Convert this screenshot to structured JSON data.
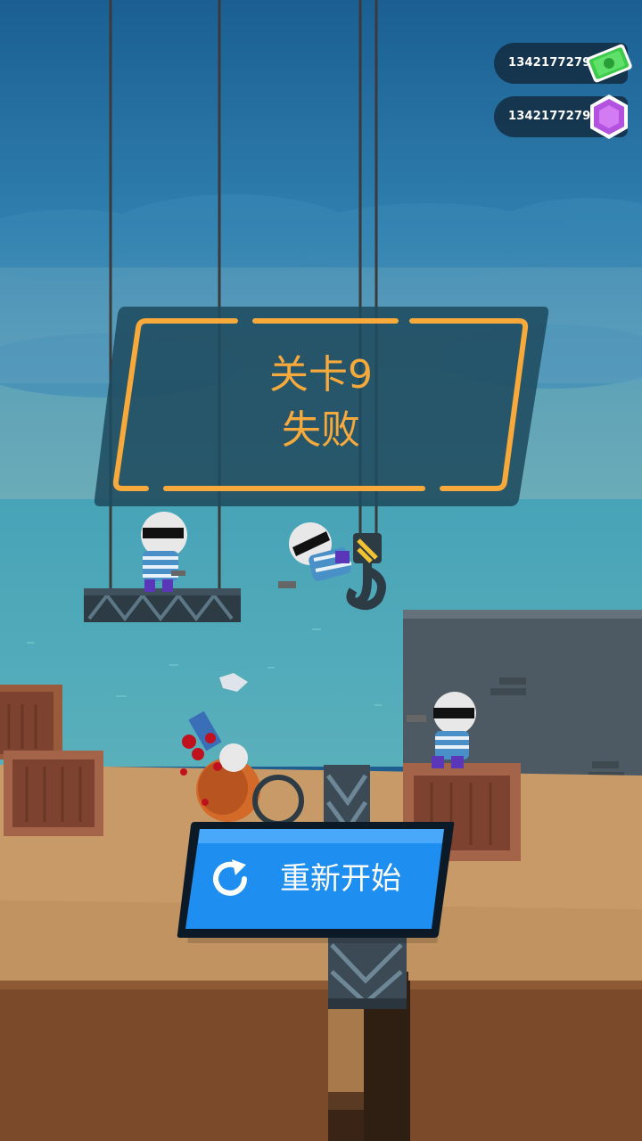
{
  "hud": {
    "cash": {
      "amount": "1342177279",
      "icon": "cash-icon",
      "color": "#3ecb4c"
    },
    "gems": {
      "amount": "1342177279",
      "icon": "gem-icon",
      "color": "#b452e0"
    }
  },
  "result_panel": {
    "title": "关卡9",
    "status": "失败",
    "accent_color": "#f7a93b"
  },
  "restart_button": {
    "label": "重新开始",
    "icon": "restart-icon",
    "color": "#1e8ef0"
  }
}
